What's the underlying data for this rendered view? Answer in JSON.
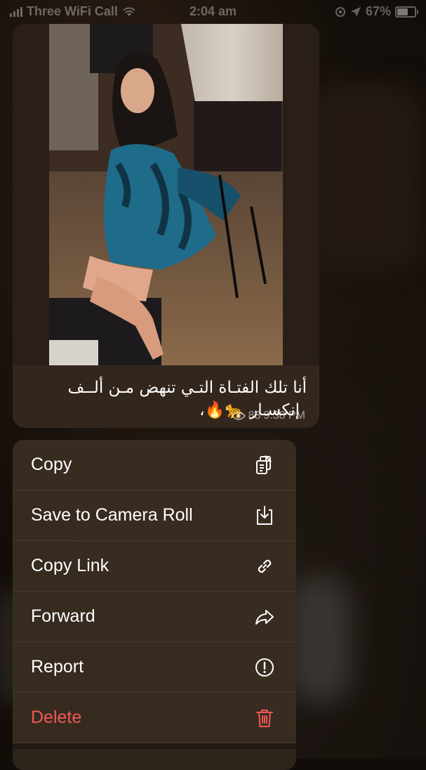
{
  "status_bar": {
    "carrier": "Three WiFi Call",
    "time": "2:04 am",
    "battery": "67%",
    "battery_level": 0.67
  },
  "message": {
    "caption_line1": "أنا تلك الفتـاة التـي تنهض مـن ألــف",
    "caption_line2": "إنكسـار 🐆🔥،",
    "views": "83",
    "time": "9:38 PM"
  },
  "context_menu": {
    "items": [
      {
        "label": "Copy",
        "icon": "copy-icon"
      },
      {
        "label": "Save to Camera Roll",
        "icon": "save-icon"
      },
      {
        "label": "Copy Link",
        "icon": "link-icon"
      },
      {
        "label": "Forward",
        "icon": "forward-icon"
      },
      {
        "label": "Report",
        "icon": "report-icon"
      },
      {
        "label": "Delete",
        "icon": "trash-icon",
        "destructive": true
      }
    ],
    "destructive_color": "#ef5a55"
  }
}
